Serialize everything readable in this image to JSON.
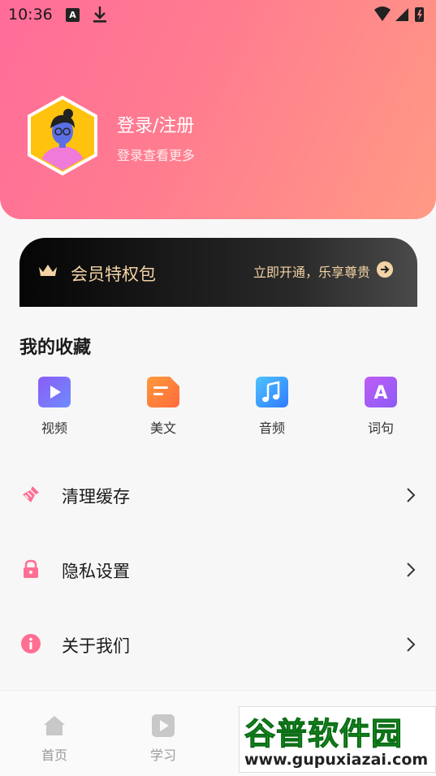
{
  "status_bar": {
    "time": "10:36",
    "notif_a": "A"
  },
  "profile": {
    "title": "登录/注册",
    "subtitle": "登录查看更多"
  },
  "vip": {
    "title": "会员特权包",
    "action": "立即开通，乐享尊贵",
    "accent_color": "#f3d2a3"
  },
  "favorites": {
    "title": "我的收藏",
    "items": [
      {
        "label": "视频",
        "icon": "video-icon",
        "color": "#8b5cf6"
      },
      {
        "label": "美文",
        "icon": "article-icon",
        "color": "#ff7a3d"
      },
      {
        "label": "音频",
        "icon": "music-icon",
        "color": "#3aa0ff"
      },
      {
        "label": "词句",
        "icon": "letter-a-icon",
        "color": "#a45cf6",
        "glyph": "A"
      }
    ]
  },
  "menu": [
    {
      "label": "清理缓存",
      "icon": "broom-icon"
    },
    {
      "label": "隐私设置",
      "icon": "lock-icon"
    },
    {
      "label": "关于我们",
      "icon": "info-icon"
    }
  ],
  "bottom_nav": [
    {
      "label": "首页",
      "icon": "home-icon"
    },
    {
      "label": "学习",
      "icon": "play-icon"
    }
  ],
  "watermark": {
    "logo": "谷普软件园",
    "url": "www.gupuxiazai.com"
  },
  "colors": {
    "header_start": "#ff6c99",
    "header_end": "#ff9a84",
    "menu_icon": "#ff6f93"
  }
}
